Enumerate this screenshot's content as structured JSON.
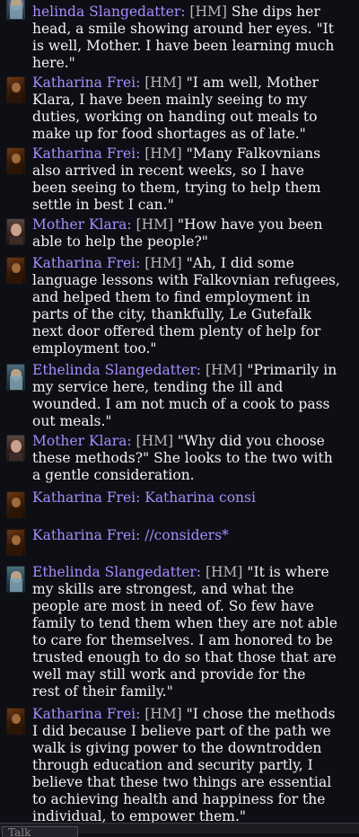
{
  "messages": [
    {
      "avatar": "ethelinda-portrait",
      "name": "Ethelinda Slangedatter:",
      "tag": "[HM]",
      "lines": [
        "helinda Slangedatter: [HM] She dips her",
        "head, a smile showing around her eyes. \"It",
        "is well, Mother. I have been learning much",
        "here.\""
      ]
    },
    {
      "avatar": "katharina-portrait",
      "name": "Katharina Frei:",
      "tag": "[HM]",
      "lines": [
        "Katharina Frei: [HM] \"I am well, Mother",
        "Klara, I have been mainly seeing to my",
        "duties, working on handing out meals to",
        "make up for food shortages as of late.\""
      ]
    },
    {
      "avatar": "katharina-portrait",
      "name": "Katharina Frei:",
      "tag": "[HM]",
      "lines": [
        "Katharina Frei: [HM] \"Many Falkovnians",
        "also arrived in recent weeks, so I have",
        "been seeing to them, trying to help them",
        "settle in best I can.\""
      ]
    },
    {
      "avatar": "klara-portrait",
      "name": "Mother Klara:",
      "tag": "[HM]",
      "lines": [
        "Mother Klara: [HM] \"How have you been",
        "able to help the people?\""
      ]
    },
    {
      "avatar": "katharina-portrait",
      "name": "Katharina Frei:",
      "tag": "[HM]",
      "lines": [
        "Katharina Frei: [HM] \"Ah, I did some",
        "language lessons with Falkovnian refugees,",
        "and helped them to find employment in",
        "parts of the city, thankfully, Le Gutefalk",
        "next door offered them plenty of help for",
        "employment too.\""
      ]
    },
    {
      "avatar": "ethelinda-portrait",
      "name": "Ethelinda Slangedatter:",
      "tag": "[HM]",
      "lines": [
        "Ethelinda Slangedatter: [HM] \"Primarily in",
        "my service here, tending the ill and",
        "wounded. I am not much of a cook to pass",
        "out meals.\""
      ]
    },
    {
      "avatar": "klara-portrait",
      "name": "Mother Klara:",
      "tag": "[HM]",
      "lines": [
        "Mother Klara: [HM] \"Why did you choose",
        "these methods?\" She looks to the two with",
        "a gentle consideration."
      ]
    },
    {
      "avatar": "katharina-portrait",
      "name": "Katharina Frei:",
      "tag": "",
      "lines": [
        "Katharina Frei: Katharina consi"
      ]
    },
    {
      "avatar": "katharina-portrait",
      "name": "Katharina Frei:",
      "tag": "",
      "lines": [
        "Katharina Frei: //considers*"
      ]
    },
    {
      "avatar": "ethelinda-portrait",
      "name": "Ethelinda Slangedatter:",
      "tag": "[HM]",
      "lines": [
        "Ethelinda Slangedatter: [HM] \"It is where",
        "my skills are strongest, and what the",
        "people are most in need of. So few have",
        "family to tend them when they are not able",
        "to care for themselves. I am honored to be",
        "trusted enough to do so that those that are",
        "well may still work and provide for the",
        "rest of their family.\""
      ]
    },
    {
      "avatar": "katharina-portrait",
      "name": "Katharina Frei:",
      "tag": "[HM]",
      "lines": [
        "Katharina Frei: [HM] \"I chose the methods",
        "I did because I believe part of the path we",
        "walk is giving power to the downtrodden",
        "through education and security partly, I",
        "believe that these two things are essential",
        "to achieving health and happiness for the",
        "individual, to empower them.\""
      ]
    }
  ],
  "input": {
    "tab_label": "Talk"
  },
  "colors": {
    "name": "#a88bff",
    "tag": "#b7b7b7",
    "text": "#f2f2f2",
    "background": "#0e0f14"
  }
}
